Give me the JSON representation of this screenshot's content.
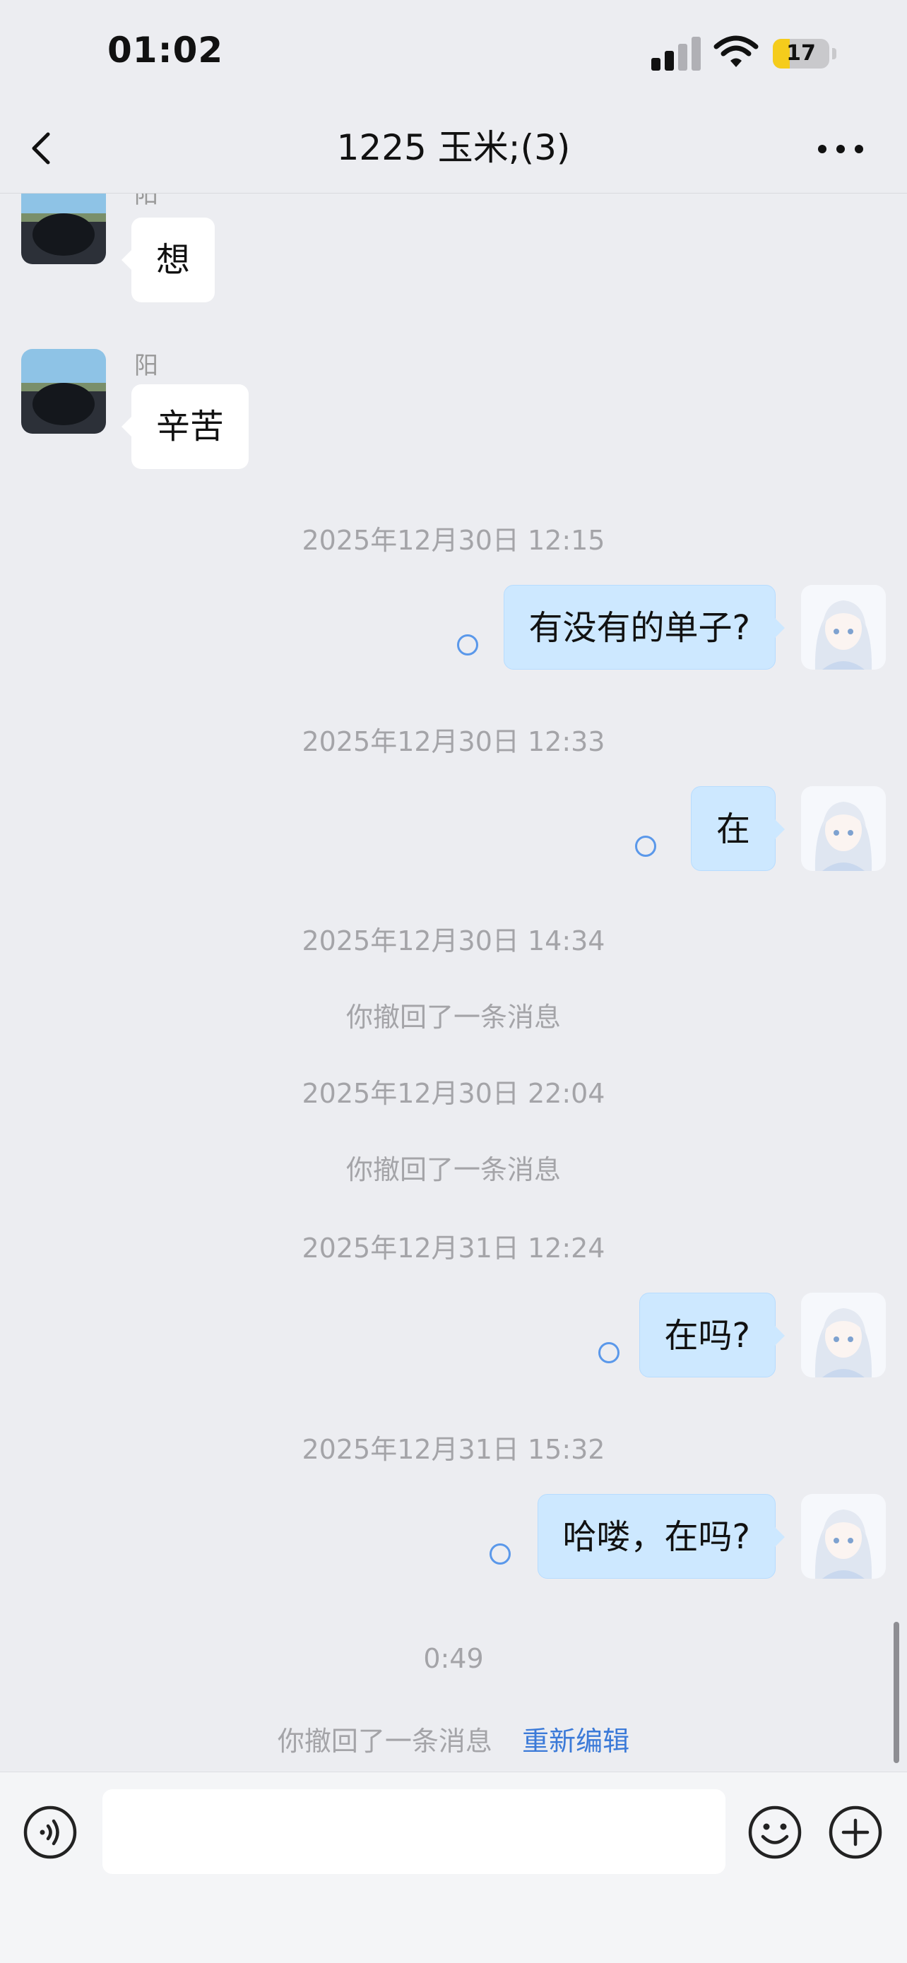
{
  "status_bar": {
    "time": "01:02",
    "battery": "17",
    "battery_level": 0.17
  },
  "nav": {
    "title": "1225 玉米;(3)"
  },
  "messages": [
    {
      "type": "incoming",
      "sender": "阳",
      "text": "想"
    },
    {
      "type": "incoming",
      "sender": "阳",
      "text": "辛苦"
    },
    {
      "type": "timestamp",
      "text": "2025年12月30日 12:15"
    },
    {
      "type": "outgoing",
      "text": "有没有的单子?"
    },
    {
      "type": "timestamp",
      "text": "2025年12月30日 12:33"
    },
    {
      "type": "outgoing",
      "text": "在"
    },
    {
      "type": "timestamp",
      "text": "2025年12月30日 14:34"
    },
    {
      "type": "system",
      "text": "你撤回了一条消息"
    },
    {
      "type": "timestamp",
      "text": "2025年12月30日 22:04"
    },
    {
      "type": "system",
      "text": "你撤回了一条消息"
    },
    {
      "type": "timestamp",
      "text": "2025年12月31日 12:24"
    },
    {
      "type": "outgoing",
      "text": "在吗?"
    },
    {
      "type": "timestamp",
      "text": "2025年12月31日 15:32"
    },
    {
      "type": "outgoing",
      "text": "哈喽，在吗?"
    },
    {
      "type": "timestamp",
      "text": "0:49"
    },
    {
      "type": "system",
      "text": "你撤回了一条消息",
      "action": "重新编辑"
    }
  ],
  "input": {
    "placeholder": ""
  },
  "colors": {
    "outgoing_bubble": "#cde8ff",
    "accent": "#3b7ad8",
    "background": "#ecedf1"
  }
}
